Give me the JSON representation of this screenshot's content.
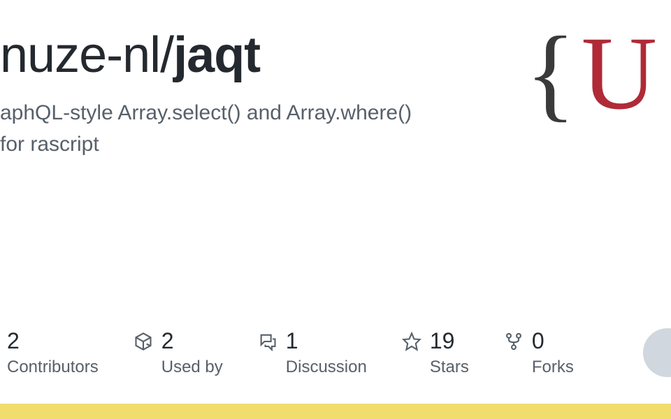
{
  "repo": {
    "owner": "nuze-nl/",
    "name": "jaqt"
  },
  "description": "aphQL-style Array.select() and Array.where() for rascript",
  "logo": {
    "brace": "{",
    "letter": "U"
  },
  "stats": [
    {
      "number": "2",
      "label": "Contributors"
    },
    {
      "number": "2",
      "label": "Used by"
    },
    {
      "number": "1",
      "label": "Discussion"
    },
    {
      "number": "19",
      "label": "Stars"
    },
    {
      "number": "0",
      "label": "Forks"
    }
  ]
}
